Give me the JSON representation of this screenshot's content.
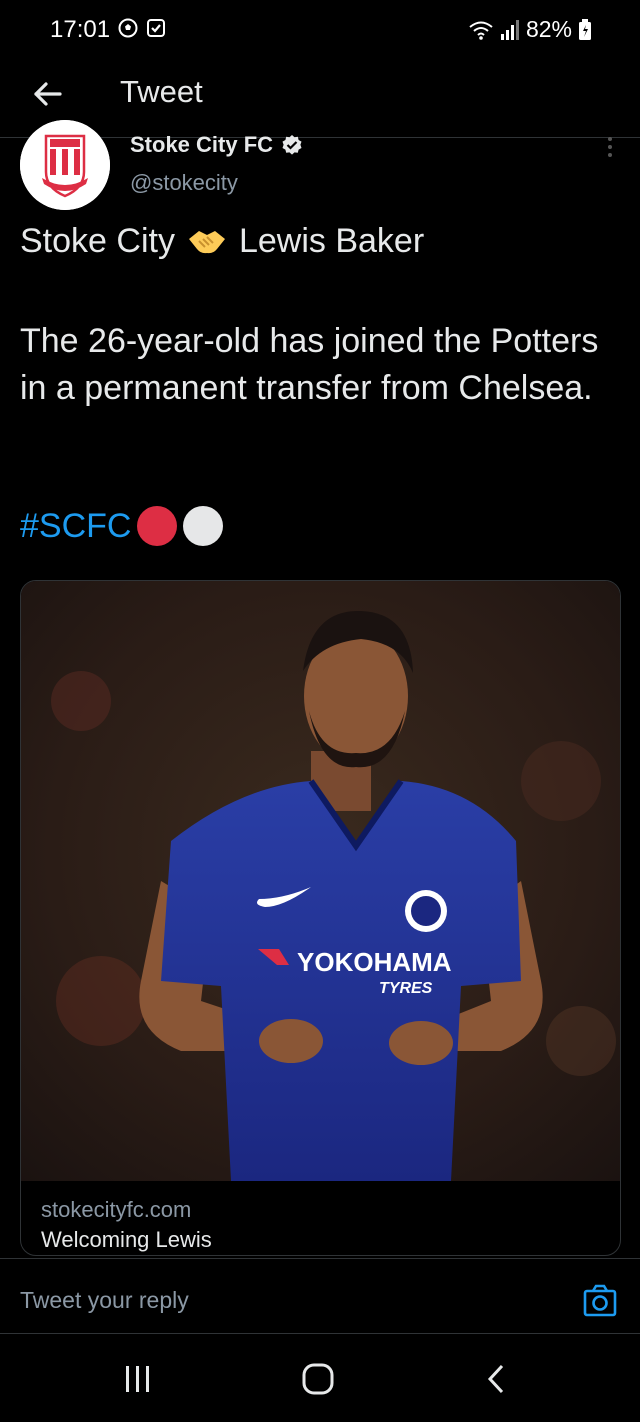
{
  "status_bar": {
    "time": "17:01",
    "battery": "82%"
  },
  "header": {
    "title": "Tweet"
  },
  "tweet": {
    "author_name": "Stoke City FC",
    "author_handle": "@stokecity",
    "line1_left": "Stoke City",
    "line1_right": "Lewis Baker",
    "body": "The 26-year-old has joined the Potters in a permanent transfer from Chelsea.",
    "hashtag": "#SCFC",
    "dot_colors": [
      "#dd2e44",
      "#e6e7e8"
    ]
  },
  "card": {
    "domain": "stokecityfc.com",
    "title": "Welcoming Lewis",
    "image_text": {
      "sponsor": "YOKOHAMA",
      "sponsor_sub": "TYRES"
    }
  },
  "reply": {
    "placeholder": "Tweet your reply"
  },
  "colors": {
    "accent": "#1d9bf0",
    "background": "#000000",
    "text_primary": "#e7e9ea",
    "text_secondary": "#8b98a5"
  },
  "icons": {
    "back": "arrow-left-icon",
    "verified": "verified-badge-icon",
    "more": "more-vertical-icon",
    "handshake": "handshake-emoji-icon",
    "camera": "camera-icon",
    "nav_recents": "recents-icon",
    "nav_home": "home-icon",
    "nav_back": "nav-back-icon"
  }
}
